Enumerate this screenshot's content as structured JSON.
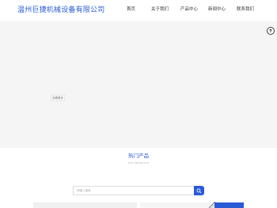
{
  "header": {
    "logo_text": "温州巨捷机械设备有限公司",
    "nav": [
      {
        "label": "首页"
      },
      {
        "label": "关于我们"
      },
      {
        "label": "产品中心"
      },
      {
        "label": "新闻中心"
      },
      {
        "label": "联系我们"
      }
    ]
  },
  "hero": {
    "line1": "",
    "line2": "",
    "button_label": "查看更多"
  },
  "products_section": {
    "title": "热门产品",
    "subtitle": "HOT PRODUCTS"
  },
  "search": {
    "placeholder": "请输入搜索"
  },
  "colors": {
    "accent": "#2a5bd7",
    "hero_bg": "#f5f5f5"
  },
  "icons": {
    "circle_button": "up-arrow-icon",
    "search_button": "search-icon"
  }
}
